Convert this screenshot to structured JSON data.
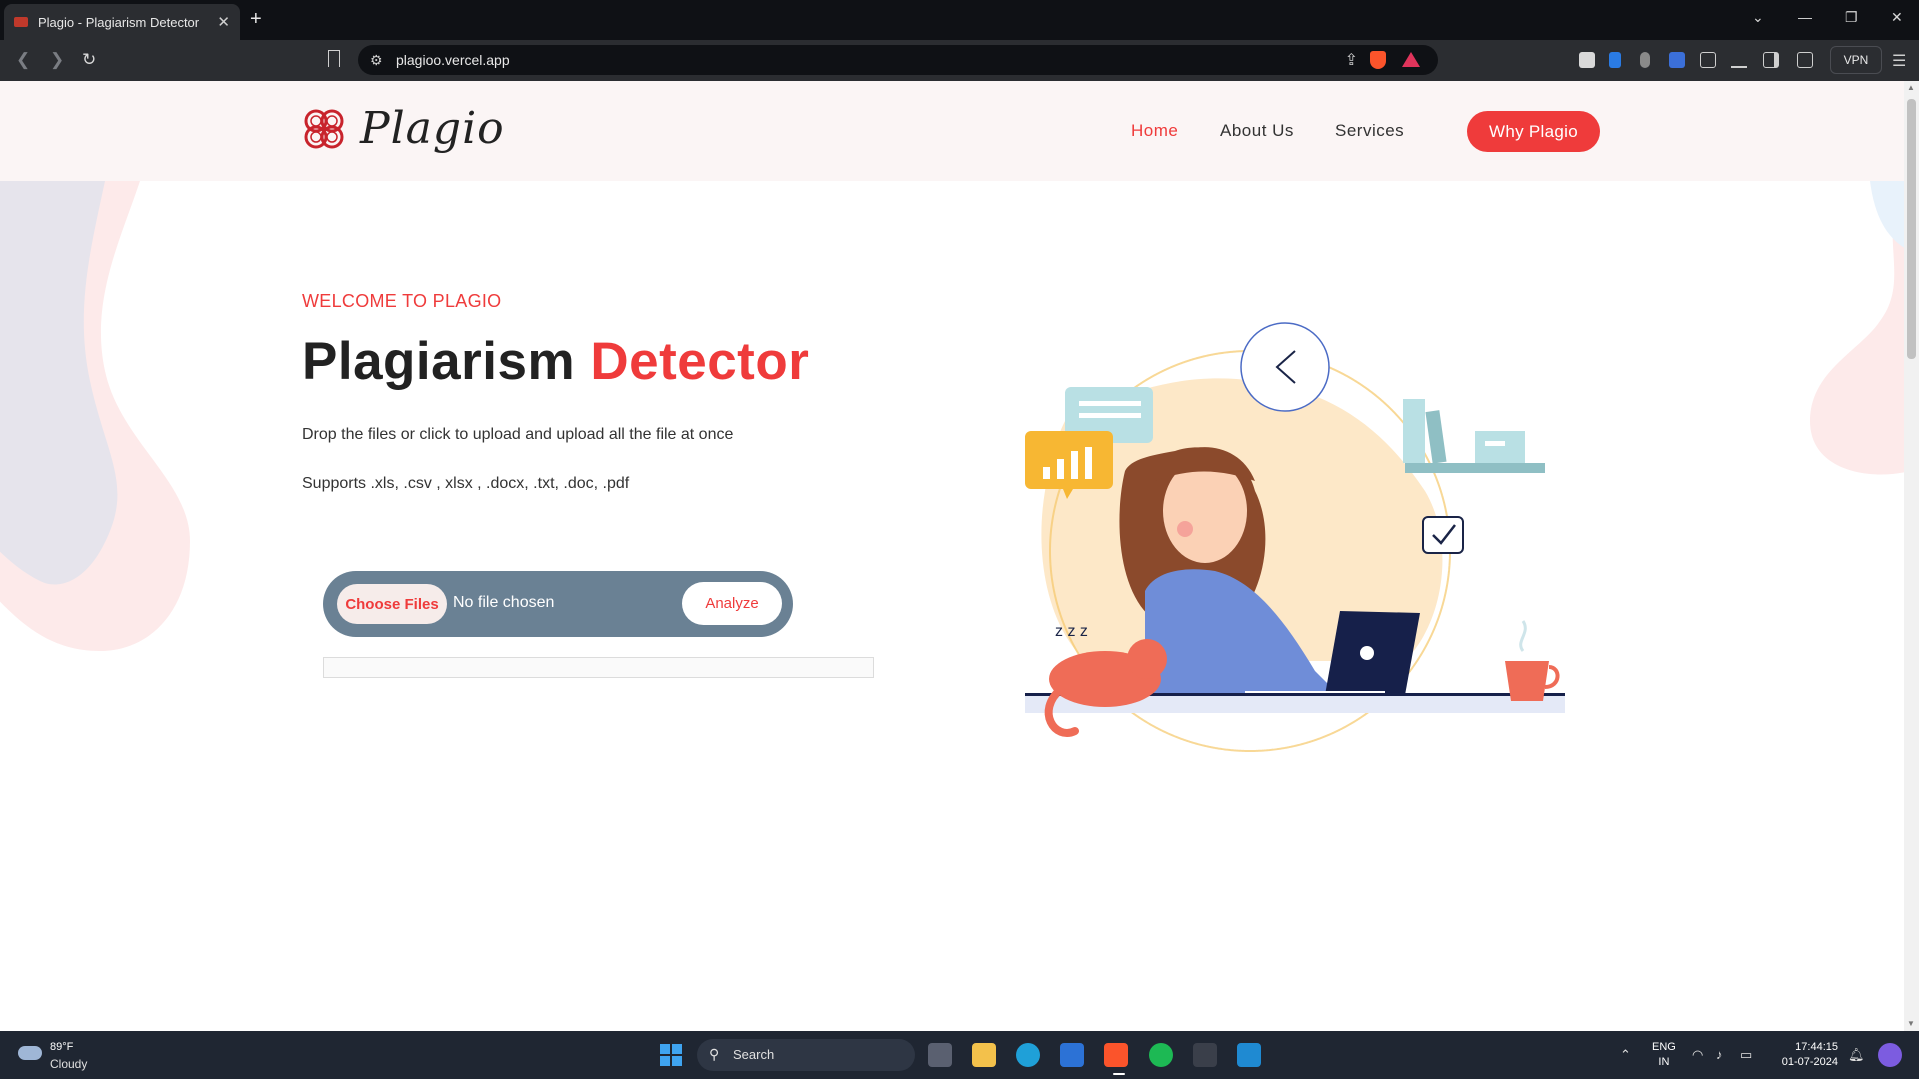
{
  "browser": {
    "tab_title": "Plagio - Plagiarism Detector",
    "new_tab": "+",
    "url": "plagioo.vercel.app",
    "vpn_label": "VPN"
  },
  "site": {
    "logo_text": "Plagio",
    "nav": {
      "home": "Home",
      "about": "About Us",
      "services": "Services"
    },
    "cta": "Why Plagio",
    "welcome": "WELCOME TO PLAGIO",
    "headline_main": "Plagiarism",
    "headline_accent": "Detector",
    "description": "Drop the files or click to upload and upload all the file at once",
    "supports": "Supports .xls, .csv , xlsx , .docx, .txt, .doc, .pdf",
    "choose_files": "Choose Files",
    "no_file": "No file chosen",
    "analyze": "Analyze"
  },
  "colors": {
    "accent": "#ef3b3b",
    "upload_bg": "#6a8194"
  },
  "taskbar": {
    "weather_temp": "89°F",
    "weather_cond": "Cloudy",
    "search_label": "Search",
    "lang_line1": "ENG",
    "lang_line2": "IN",
    "time": "17:44:15",
    "date": "01-07-2024"
  }
}
